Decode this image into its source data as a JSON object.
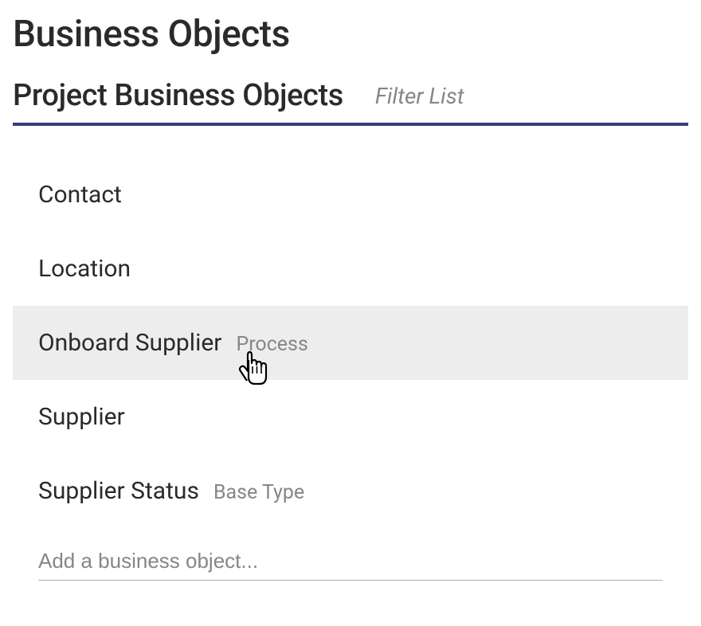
{
  "page_title": "Business Objects",
  "section_title": "Project Business Objects",
  "filter_label": "Filter List",
  "list": [
    {
      "label": "Contact",
      "subtype": ""
    },
    {
      "label": "Location",
      "subtype": ""
    },
    {
      "label": "Onboard Supplier",
      "subtype": "Process",
      "hovered": true
    },
    {
      "label": "Supplier",
      "subtype": ""
    },
    {
      "label": "Supplier Status",
      "subtype": "Base Type"
    }
  ],
  "add_placeholder": "Add a business object..."
}
